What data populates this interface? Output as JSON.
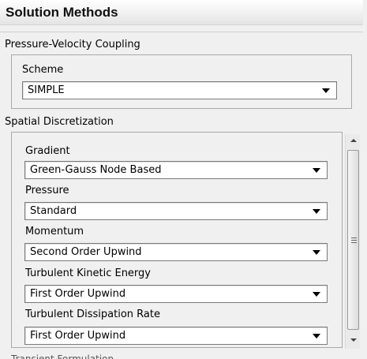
{
  "panel": {
    "title": "Solution Methods"
  },
  "pv_coupling": {
    "section_label": "Pressure-Velocity Coupling",
    "scheme_label": "Scheme",
    "scheme_value": "SIMPLE"
  },
  "spatial": {
    "section_label": "Spatial Discretization",
    "fields": [
      {
        "label": "Gradient",
        "value": "Green-Gauss Node Based"
      },
      {
        "label": "Pressure",
        "value": "Standard"
      },
      {
        "label": "Momentum",
        "value": "Second Order Upwind"
      },
      {
        "label": "Turbulent Kinetic Energy",
        "value": "First Order Upwind"
      },
      {
        "label": "Turbulent Dissipation Rate",
        "value": "First Order Upwind"
      }
    ]
  },
  "footer": {
    "partial_text": "Transient Formulation"
  },
  "icons": {
    "combo_arrow": "chevron-down-icon",
    "scroll_up": "scroll-up-icon",
    "scroll_down": "scroll-down-icon"
  }
}
